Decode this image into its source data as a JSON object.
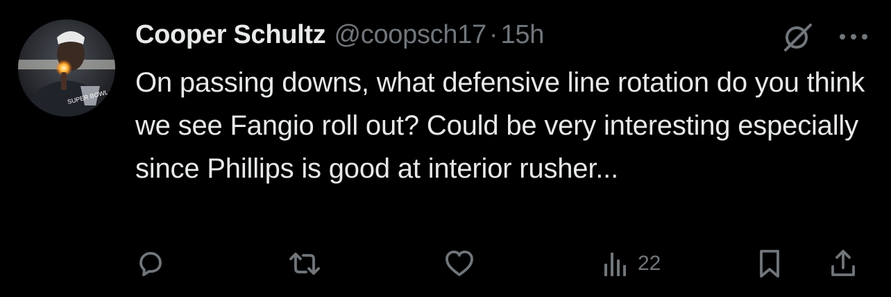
{
  "tweet": {
    "author": {
      "display_name": "Cooper Schultz",
      "handle": "@coopsch17",
      "separator": "·",
      "time": "15h",
      "avatar_text": "SUPER BOWL CHAMPI"
    },
    "text": "On passing downs, what defensive line rotation do you think we see Fangio roll out? Could be very interesting especially since Phillips is good at interior rusher...",
    "top_icons": [
      "grok-icon",
      "more-icon"
    ],
    "actions": {
      "reply": {
        "icon": "reply-icon"
      },
      "retweet": {
        "icon": "retweet-icon"
      },
      "like": {
        "icon": "heart-icon"
      },
      "views": {
        "icon": "views-icon",
        "count": "22"
      },
      "bookmark": {
        "icon": "bookmark-icon"
      },
      "share": {
        "icon": "share-icon"
      }
    },
    "colors": {
      "background": "#000000",
      "text": "#e7e9ea",
      "muted": "#71767b"
    }
  }
}
